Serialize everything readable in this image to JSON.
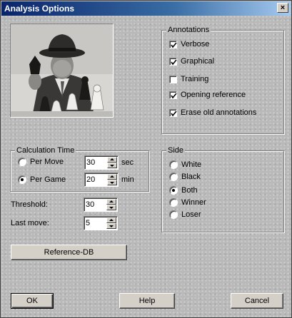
{
  "window": {
    "title": "Analysis Options",
    "close_label": "×"
  },
  "photo": {
    "description_icon": "chess-player-photo-icon"
  },
  "annotations": {
    "legend": "Annotations",
    "items": [
      {
        "label": "Verbose",
        "checked": true
      },
      {
        "label": "Graphical",
        "checked": true
      },
      {
        "label": "Training",
        "checked": false
      },
      {
        "label": "Opening reference",
        "checked": true
      },
      {
        "label": "Erase old annotations",
        "checked": true
      }
    ]
  },
  "calculation": {
    "legend": "Calculation Time",
    "per_move": {
      "label": "Per Move",
      "selected": false,
      "value": "30",
      "unit": "sec"
    },
    "per_game": {
      "label": "Per Game",
      "selected": true,
      "value": "20",
      "unit": "min"
    }
  },
  "threshold": {
    "label": "Threshold:",
    "value": "30"
  },
  "last_move": {
    "label": "Last move:",
    "value": "5"
  },
  "side": {
    "legend": "Side",
    "options": [
      {
        "label": "White",
        "selected": false
      },
      {
        "label": "Black",
        "selected": false
      },
      {
        "label": "Both",
        "selected": true
      },
      {
        "label": "Winner",
        "selected": false
      },
      {
        "label": "Loser",
        "selected": false
      }
    ]
  },
  "buttons": {
    "reference_db": "Reference-DB",
    "ok": "OK",
    "help": "Help",
    "cancel": "Cancel"
  }
}
